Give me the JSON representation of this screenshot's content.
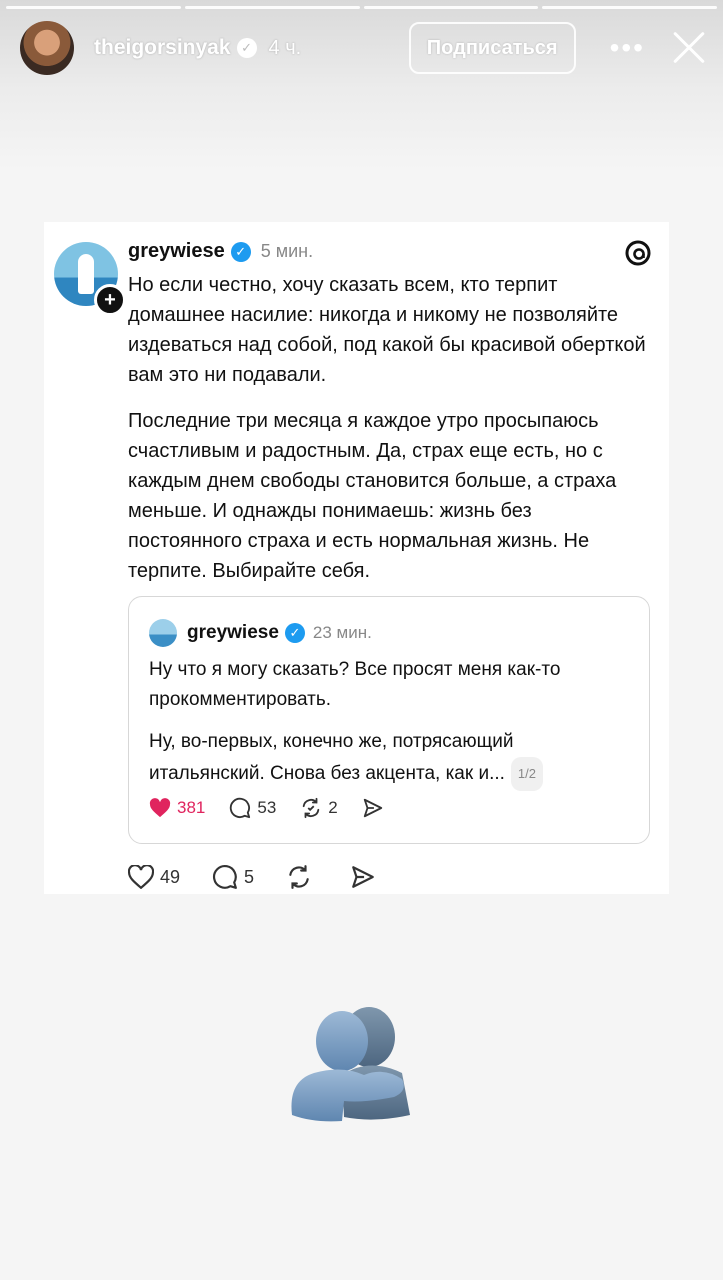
{
  "story": {
    "username": "theigorsinyak",
    "time": "4 ч.",
    "subscribe_label": "Подписаться",
    "more_label": "•••"
  },
  "post": {
    "username": "greywiese",
    "time": "5 мин.",
    "paragraphs": [
      "Но если честно, хочу сказать всем, кто терпит домашнее насилие: никогда и никому не позволяйте издеваться над собой, под какой бы красивой оберткой вам это ни подавали.",
      "Последние три месяца я каждое утро просыпаюсь счастливым и радостным. Да, страх еще есть, но с каждым днем свободы становится больше, а страха меньше. И однажды понимаешь: жизнь без постоянного страха и есть нормальная жизнь. Не терпите. Выбирайте себя."
    ],
    "likes": "49",
    "comments": "5",
    "quote": {
      "username": "greywiese",
      "time": "23 мин.",
      "paragraphs": [
        "Ну что я могу сказать? Все просят меня как-то прокомментировать.",
        "Ну, во-первых, конечно же, потрясающий итальянский. Снова без акцента, как и..."
      ],
      "page_indicator": "1/2",
      "likes": "381",
      "comments": "53",
      "reposts": "2"
    }
  },
  "colors": {
    "verified": "#1d9bf0",
    "like_red": "#e0245e"
  },
  "sticker_icon": "people-hugging-emoji"
}
